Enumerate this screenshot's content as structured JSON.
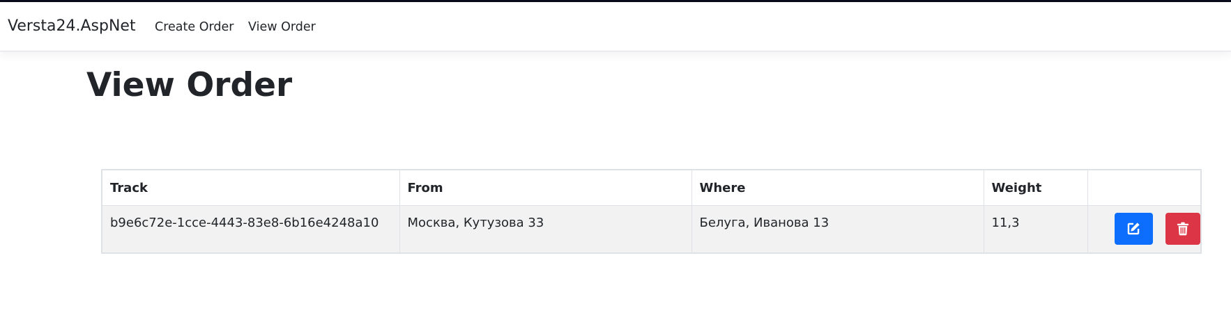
{
  "navbar": {
    "brand": "Versta24.AspNet",
    "links": [
      {
        "label": "Create Order"
      },
      {
        "label": "View Order"
      }
    ]
  },
  "page": {
    "title": "View Order"
  },
  "orders_table": {
    "columns": [
      "Track",
      "From",
      "Where",
      "Weight",
      ""
    ],
    "rows": [
      {
        "track": "b9e6c72e-1cce-4443-83e8-6b16e4248a10",
        "from": "Москва, Кутузова 33",
        "where": "Белуга, Иванова 13",
        "weight": "11,3",
        "actions": [
          {
            "icon": "edit-icon",
            "color": "#0d6efd"
          },
          {
            "icon": "trash-icon",
            "color": "#dc3545"
          }
        ]
      }
    ]
  }
}
